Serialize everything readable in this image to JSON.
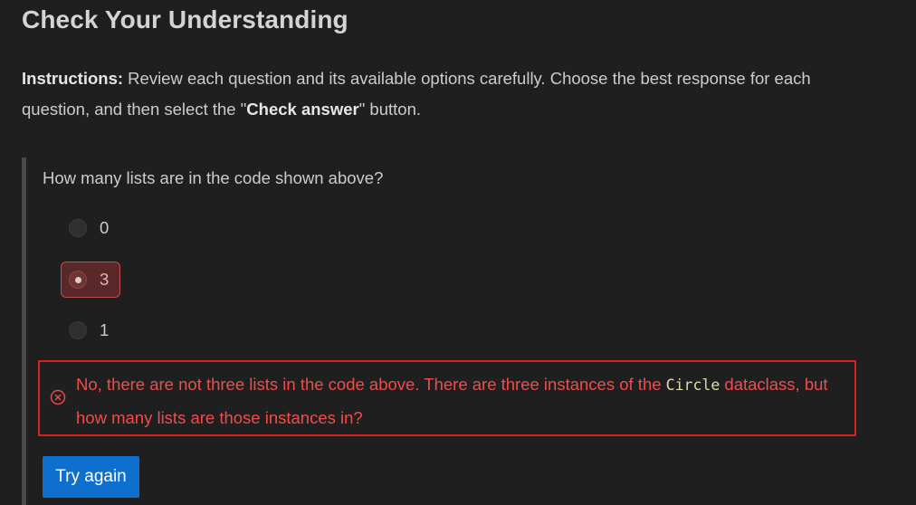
{
  "page": {
    "title": "Check Your Understanding"
  },
  "instructions": {
    "label": "Instructions:",
    "text_1": " Review each question and its available options carefully. Choose the best response for each question, and then select the \"",
    "button_ref": "Check answer",
    "text_2": "\" button."
  },
  "question": {
    "text": "How many lists are in the code shown above?",
    "options": [
      {
        "label": "0",
        "selected": false
      },
      {
        "label": "3",
        "selected": true,
        "state": "incorrect"
      },
      {
        "label": "1",
        "selected": false
      }
    ]
  },
  "feedback": {
    "icon": "error-circle-x-icon",
    "text_before": "No, there are not three lists in the code above. There are three instances of the ",
    "code": "Circle",
    "text_after": " dataclass, but how many lists are those instances in?"
  },
  "actions": {
    "try_again_label": "Try again"
  },
  "colors": {
    "background": "#1f1f1f",
    "error": "#f14c4c",
    "error_border": "#d42121",
    "button": "#0e6fcf",
    "selected_wrong_bg": "#5a2828"
  }
}
